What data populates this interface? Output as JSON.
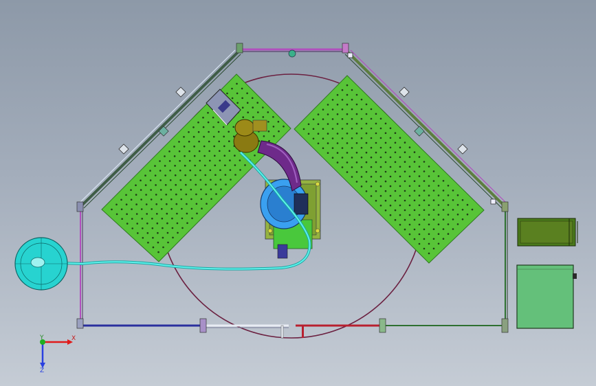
{
  "triad": {
    "x_label": "X",
    "y_label": "Y",
    "z_label": "Z"
  },
  "colors": {
    "table": "#58c438",
    "table_edge": "#2f7a1f",
    "hole": "#1f3d17",
    "track": "#6b2040",
    "fence_pink": "#b04fbd",
    "fence_blue": "#2a2f9e",
    "fence_red": "#b8202f",
    "fence_white": "#e8ecf4",
    "fence_green": "#2e7030",
    "cable": "#5ff0ea",
    "spool": "#27d3d0",
    "robot_base": "#3aa0f0",
    "robot_arm": "#6e2a8a",
    "robot_joint": "#8a7a12",
    "cabinet": "#64c07a",
    "motor": "#5a8020"
  }
}
